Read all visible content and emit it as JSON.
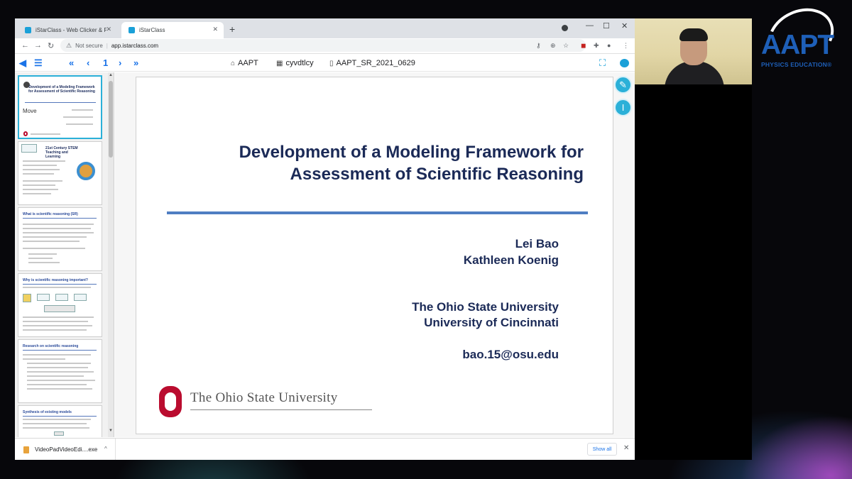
{
  "browser": {
    "tabs": [
      {
        "title": "iStarClass - Web Clicker & Prese",
        "active": false
      },
      {
        "title": "iStarClass",
        "active": true
      }
    ],
    "security_label": "Not secure",
    "url": "app.istarclass.com"
  },
  "toolbar": {
    "page_number": "1",
    "organization": "AAPT",
    "class_code": "cyvdtlcy",
    "file_name": "AAPT_SR_2021_0629"
  },
  "thumbnails": [
    {
      "title": "Development of a Modeling Framework for Assessment of Scientific Reasoning",
      "label": "Move",
      "selected": true
    },
    {
      "title": "21st Century STEM Teaching and Learning",
      "selected": false
    },
    {
      "title": "What is scientific reasoning (SR)",
      "selected": false
    },
    {
      "title": "Why is scientific reasoning important?",
      "selected": false
    },
    {
      "title": "Research on scientific reasoning",
      "selected": false
    },
    {
      "title": "Synthesis of existing models",
      "selected": false
    }
  ],
  "slide": {
    "title_line1": "Development of a Modeling Framework for",
    "title_line2": "Assessment of Scientific Reasoning",
    "author1": "Lei Bao",
    "author2": "Kathleen Koenig",
    "affiliation1": "The Ohio State University",
    "affiliation2": "University of Cincinnati",
    "email": "bao.15@osu.edu",
    "logo_text": "The Ohio State University"
  },
  "downloads": {
    "file_name": "VideoPadVideoEdi....exe",
    "show_all_label": "Show all"
  },
  "overlay_logo": {
    "name": "AAPT",
    "tagline": "PHYSICS EDUCATION®"
  },
  "colors": {
    "accent": "#1aa0d8",
    "slide_title": "#1b2a57",
    "rule": "#4f7ec2",
    "osu_red": "#ba0c2f",
    "aapt_blue": "#1e5fb8"
  }
}
